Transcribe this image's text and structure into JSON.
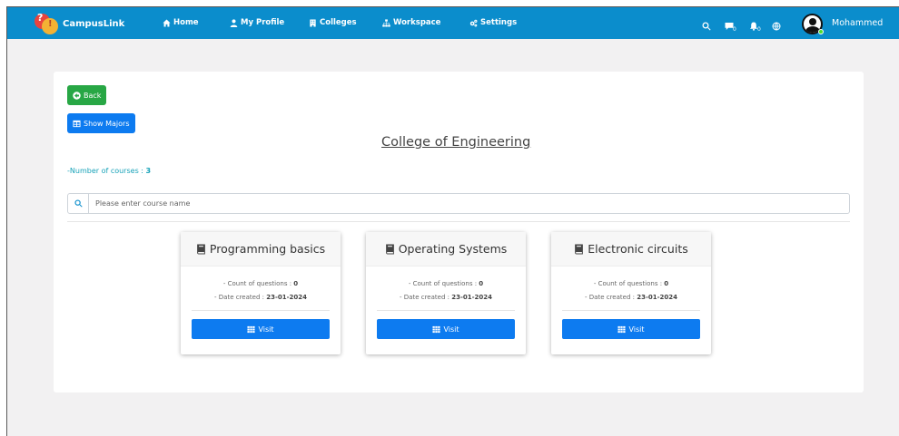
{
  "brand": {
    "name": "CampusLink"
  },
  "nav": {
    "home": "Home",
    "profile": "My Profile",
    "colleges": "Colleges",
    "workspace": "Workspace",
    "settings": "Settings"
  },
  "topbar": {
    "messages_count": "0",
    "notifications_count": "0",
    "username": "Mohammed"
  },
  "page": {
    "back_label": "Back",
    "show_majors_label": "Show Majors",
    "title": "College of Engineering",
    "num_courses_label": "-Number of courses : ",
    "num_courses_value": "3",
    "search_placeholder": "Please enter course name"
  },
  "courses": [
    {
      "name": "Programming basics",
      "questions_label": "- Count of questions : ",
      "questions": "0",
      "date_label": "- Date created : ",
      "date": "23-01-2024",
      "visit": "Visit"
    },
    {
      "name": "Operating Systems",
      "questions_label": "- Count of questions : ",
      "questions": "0",
      "date_label": "- Date created : ",
      "date": "23-01-2024",
      "visit": "Visit"
    },
    {
      "name": "Electronic circuits",
      "questions_label": "- Count of questions : ",
      "questions": "0",
      "date_label": "- Date created : ",
      "date": "23-01-2024",
      "visit": "Visit"
    }
  ],
  "icons": {
    "logo": "campuslink-logo",
    "home": "home-icon",
    "profile": "user-icon",
    "colleges": "building-icon",
    "workspace": "sitemap-icon",
    "settings": "gears-icon",
    "search": "search-icon",
    "messages": "chat-icon",
    "notifications": "bell-icon",
    "language": "globe-icon",
    "back": "circle-arrow-left-icon",
    "majors": "table-icon",
    "course": "book-icon",
    "visit": "grid-icon"
  },
  "colors": {
    "navbar": "#0b8dcc",
    "back_button": "#28a745",
    "primary_button": "#0d7bf0",
    "info_text": "#17a2b8",
    "online": "#4ade2c"
  }
}
